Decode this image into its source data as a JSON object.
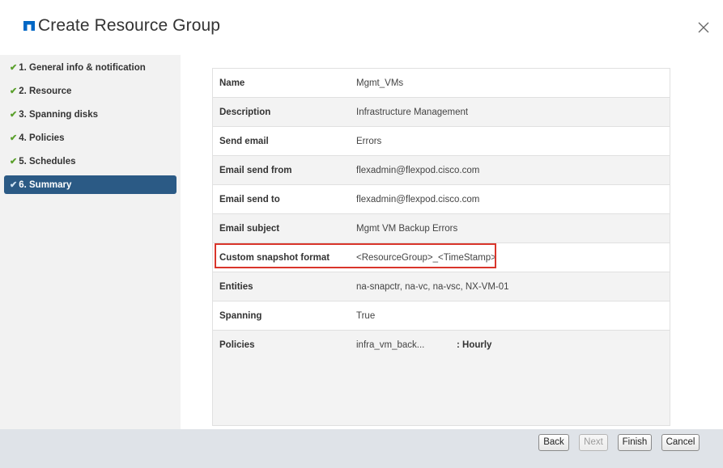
{
  "header": {
    "title": "Create Resource Group",
    "logo_icon": "netapp-logo-icon",
    "close_icon": "close-icon"
  },
  "sidebar": {
    "check_glyph": "✔",
    "steps": [
      {
        "label": "1. General info & notification",
        "completed": true,
        "active": false
      },
      {
        "label": "2. Resource",
        "completed": true,
        "active": false
      },
      {
        "label": "3. Spanning disks",
        "completed": true,
        "active": false
      },
      {
        "label": "4. Policies",
        "completed": true,
        "active": false
      },
      {
        "label": "5. Schedules",
        "completed": true,
        "active": false
      },
      {
        "label": "6. Summary",
        "completed": true,
        "active": true
      }
    ]
  },
  "summary": {
    "rows": [
      {
        "label": "Name",
        "value": "Mgmt_VMs"
      },
      {
        "label": "Description",
        "value": "Infrastructure Management"
      },
      {
        "label": "Send email",
        "value": "Errors"
      },
      {
        "label": "Email send from",
        "value": "flexadmin@flexpod.cisco.com"
      },
      {
        "label": "Email send to",
        "value": "flexadmin@flexpod.cisco.com"
      },
      {
        "label": "Email subject",
        "value": "Mgmt VM Backup Errors"
      },
      {
        "label": "Custom snapshot format",
        "value": "<ResourceGroup>_<TimeStamp>"
      },
      {
        "label": "Entities",
        "value": "na-snapctr, na-vc, na-vsc, NX-VM-01"
      },
      {
        "label": "Spanning",
        "value": "True"
      },
      {
        "label": "Policies",
        "value": "infra_vm_back...",
        "value2": ": Hourly"
      }
    ]
  },
  "footer": {
    "back_label": "Back",
    "next_label": "Next",
    "finish_label": "Finish",
    "cancel_label": "Cancel"
  },
  "colors": {
    "active_step": "#2b5a85",
    "check": "#5aa02c",
    "highlight": "#d9352b",
    "footer_bg": "#dfe3e8",
    "sidebar_bg": "#f2f2f2",
    "logo": "#0067c5"
  }
}
